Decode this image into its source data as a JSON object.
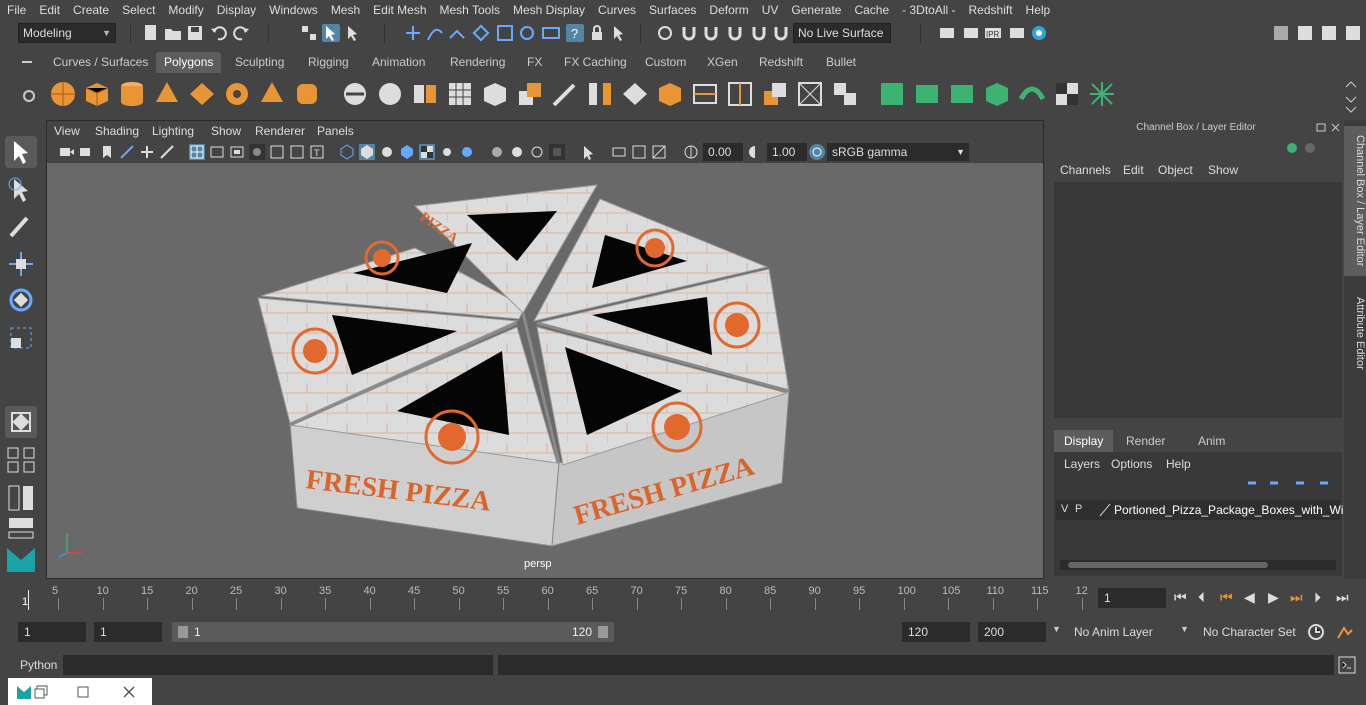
{
  "menubar": [
    "File",
    "Edit",
    "Create",
    "Select",
    "Modify",
    "Display",
    "Windows",
    "Mesh",
    "Edit Mesh",
    "Mesh Tools",
    "Mesh Display",
    "Curves",
    "Surfaces",
    "Deform",
    "UV",
    "Generate",
    "Cache",
    "- 3DtoAll -",
    "Redshift",
    "Help"
  ],
  "status": {
    "mode": "Modeling",
    "live_surface": "No Live Surface"
  },
  "shelf_tabs": [
    "Curves / Surfaces",
    "Polygons",
    "Sculpting",
    "Rigging",
    "Animation",
    "Rendering",
    "FX",
    "FX Caching",
    "Custom",
    "XGen",
    "Redshift",
    "Bullet"
  ],
  "viewport": {
    "menu": [
      "View",
      "Shading",
      "Lighting",
      "Show",
      "Renderer",
      "Panels"
    ],
    "exposure": "0.00",
    "gamma": "1.00",
    "colorspace": "sRGB gamma",
    "camera": "persp",
    "box_text": "FRESH PIZZA",
    "box_text_short": "PIZZA",
    "box_text_side": "FRESH PIZZA"
  },
  "channelbox": {
    "title": "Channel Box / Layer Editor",
    "menu": [
      "Channels",
      "Edit",
      "Object",
      "Show"
    ],
    "layer_tabs": [
      "Display",
      "Render",
      "Anim"
    ],
    "layer_menu": [
      "Layers",
      "Options",
      "Help"
    ],
    "layer": {
      "v": "V",
      "p": "P",
      "name": "Portioned_Pizza_Package_Boxes_with_Wind"
    },
    "side_tabs": [
      "Channel Box / Layer Editor",
      "Attribute Editor"
    ]
  },
  "timeline": {
    "ticks": [
      "5",
      "10",
      "15",
      "20",
      "25",
      "30",
      "35",
      "40",
      "45",
      "50",
      "55",
      "60",
      "65",
      "70",
      "75",
      "80",
      "85",
      "90",
      "95",
      "100",
      "105",
      "110",
      "115",
      "12"
    ],
    "start_marker": "1",
    "current_frame": "1"
  },
  "range": {
    "start": "1",
    "start2": "1",
    "bar_start": "1",
    "bar_end": "120",
    "end": "120",
    "end2": "200",
    "anim_layer": "No Anim Layer",
    "char_set": "No Character Set"
  },
  "python": {
    "label": "Python"
  },
  "accent": "#5285a6"
}
